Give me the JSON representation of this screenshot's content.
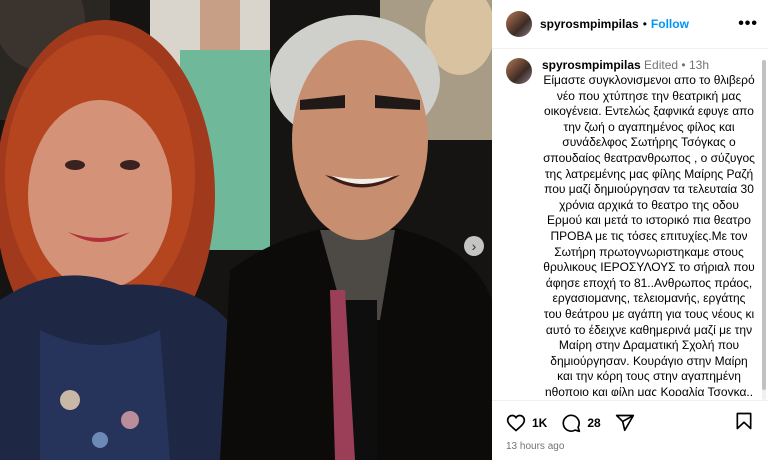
{
  "post": {
    "username": "spyrosmpimpilas",
    "follow_label": "Follow",
    "more_label": "•••",
    "carousel_next": "›"
  },
  "caption": {
    "username": "spyrosmpimpilas",
    "edited": "Edited",
    "time": "13h",
    "text": "Είμαστε συγκλονισμενοι απο το θλιβερό νέο που χτύπησε την θεατρική μας οικογένεια.  Εντελώς ξαφνικά εφυγε απο την ζωή ο αγαπημένος φίλος και συνάδελφος Σωτήρης Τσόγκας ο σπουδαίος θεατρανθρωπος , ο σύζυγος της λατρεμένης μας φίλης Μαίρης Ραζή που μαζί δημιούργησαν τα τελευταία 30 χρόνια αρχικά το θεατρο της οδου Ερμού και μετά το ιστορικό πια θεατρο ΠΡΟΒΑ με τις τόσες επιτυχίες.Με τον Σωτήρη πρωτογνωριστηκαμε στους θρυλικους ΙΕΡΟΣΥΛΟΥΣ  το σήριαλ που άφησε εποχή το 81..Ανθρωπος πράος, εργασιομανης, τελειομανής, εργάτης του θεάτρου με αγάπη για τους νέους  κι αυτό το έδειχνε καθημερινά μαζί με την Μαίρη στην Δραματική Σχολή που δημιούργησαν.  Κουράγιο στην Μαίρη και την κόρη τους στην αγαπημένη ηθοποιο και φίλη μας Κοραλία Τσογκα.. Καλό ταξιδι"
  },
  "actions": {
    "likes": "1K",
    "comments": "28",
    "timestamp": "13 hours ago"
  },
  "icons": [
    "heart-icon",
    "comment-icon",
    "share-icon",
    "bookmark-icon",
    "more-icon",
    "chevron-right-icon"
  ],
  "colors": {
    "follow": "#0095f6",
    "muted": "#737373",
    "border": "#efefef"
  }
}
